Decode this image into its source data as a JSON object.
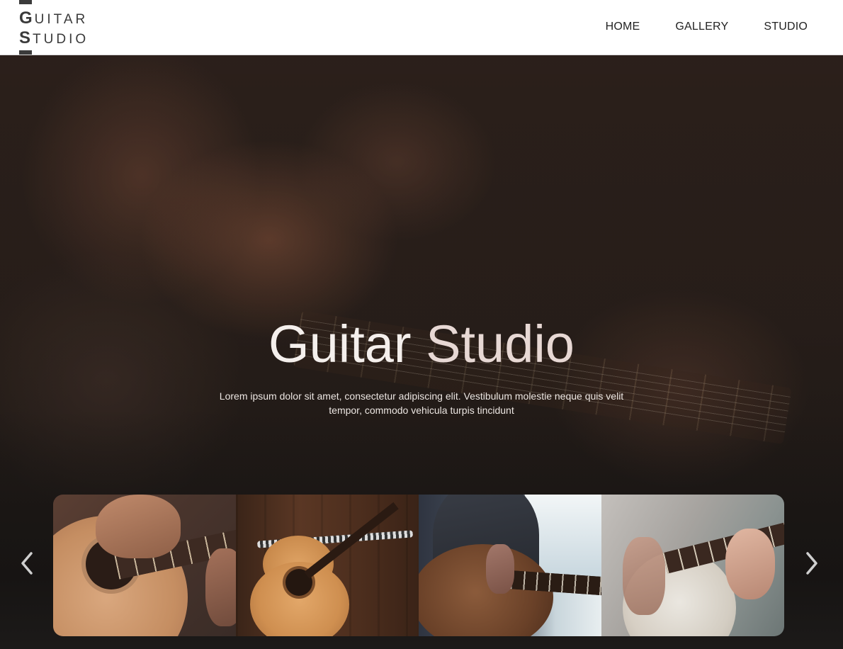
{
  "logo": {
    "line1_initial": "G",
    "line1_rest": "UITAR",
    "line2_initial": "S",
    "line2_rest": "TUDIO"
  },
  "nav": {
    "items": [
      {
        "label": "HOME"
      },
      {
        "label": "GALLERY"
      },
      {
        "label": "STUDIO"
      }
    ]
  },
  "hero": {
    "title_part1": "Guitar",
    "title_part2": "Studio",
    "description": "Lorem ipsum dolor sit amet, consectetur adipiscing elit. Vestibulum molestie neque quis velit tempor, commodo vehicula turpis tincidunt"
  },
  "carousel": {
    "prev_icon": "chevron-left-icon",
    "next_icon": "chevron-right-icon"
  },
  "colors": {
    "header_bg": "#ffffff",
    "logo_text": "#3a3a3a",
    "hero_title": "#f4efec",
    "hero_title_accent": "#e7d8d4",
    "page_bg": "#1e1b1a"
  }
}
